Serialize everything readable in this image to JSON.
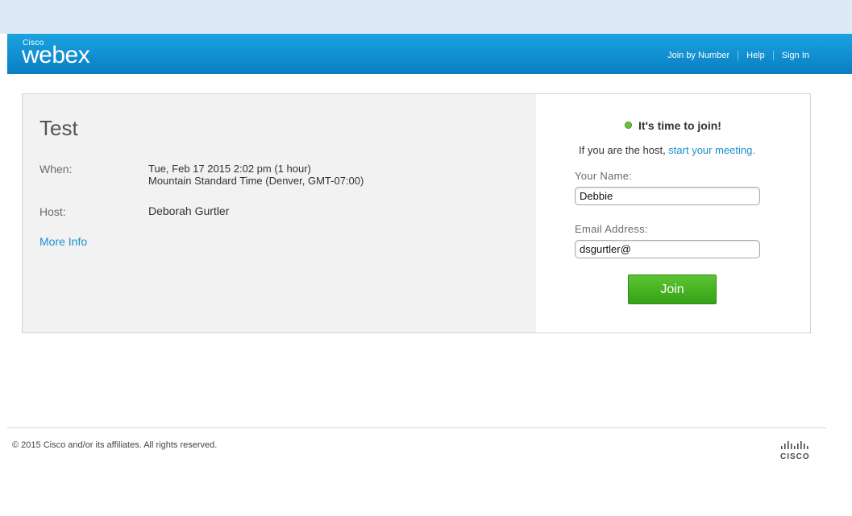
{
  "header": {
    "brand_small": "Cisco",
    "brand_main": "webex",
    "nav": [
      "Join by Number",
      "Help",
      "Sign In"
    ]
  },
  "meeting": {
    "title": "Test",
    "when_label": "When:",
    "when_line1": "Tue, Feb 17 2015 2:02 pm (1 hour)",
    "when_line2": "Mountain Standard Time (Denver, GMT-07:00)",
    "host_label": "Host:",
    "host_value": "Deborah Gurtler",
    "more_info": "More Info"
  },
  "join": {
    "status": "It's time to join!",
    "host_prefix": "If you are the host, ",
    "host_link": "start your meeting.",
    "name_label": "Your Name:",
    "name_value": "Debbie",
    "email_label": "Email Address:",
    "email_value": "dsgurtler@",
    "button": "Join"
  },
  "footer": {
    "copyright": "© 2015 Cisco and/or its affiliates. All rights reserved.",
    "logo_text": "CISCO"
  },
  "colors": {
    "header": "#0a7ec2",
    "link": "#1a8fd0",
    "join_button": "#4cb526",
    "status_dot": "#6ac23a"
  },
  "icons": [
    "status-dot-icon",
    "cisco-logo-icon"
  ]
}
